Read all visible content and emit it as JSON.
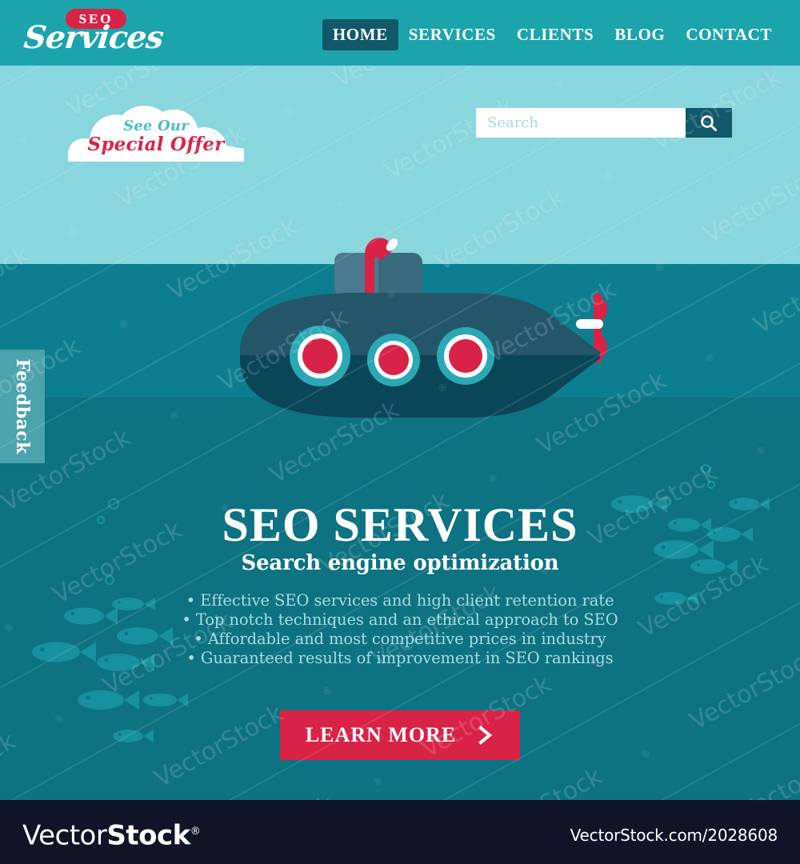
{
  "site": {
    "logo": {
      "badge_text": "SEO",
      "script_text": "Services",
      "badge_color": "#d92346"
    }
  },
  "header": {
    "background": "#1ca4ad",
    "nav": [
      {
        "label": "HOME",
        "active": true
      },
      {
        "label": "SERVICES",
        "active": false
      },
      {
        "label": "CLIENTS",
        "active": false
      },
      {
        "label": "BLOG",
        "active": false
      },
      {
        "label": "CONTACT",
        "active": false
      }
    ]
  },
  "promo": {
    "line1": "See Our",
    "line2": "Special Offer",
    "line1_color": "#4cbcc9",
    "line2_color": "#d92346"
  },
  "search": {
    "value": "",
    "placeholder": "Search",
    "icon": "search-icon",
    "button_color": "#11586a"
  },
  "feedback": {
    "label": "Feedback",
    "background": "#4ba3ad"
  },
  "hero": {
    "title": "SEO SERVICES",
    "subtitle": "Search engine optimization",
    "bullets": [
      "• Effective SEO services and high client retention rate",
      "• Top notch techniques and an ethical approach to SEO",
      "• Affordable and most competitive prices in industry",
      "• Guaranteed results of improvement in SEO rankings"
    ],
    "cta_label": "LEARN MORE",
    "cta_icon": "chevron-right-icon",
    "cta_color": "#d92346"
  },
  "illustration": {
    "name": "submarine-illustration",
    "sky_color": "#8ad6dd",
    "sea_color": "#0d7e8f",
    "deep_sea_color": "#0d7282",
    "hull_top_color": "#24566a",
    "hull_bottom_color": "#0a4558",
    "periscope_color": "#d92346",
    "porthole_ring_color": "#2ba8b5",
    "porthole_glass_color": "#d92346",
    "propeller_color": "#d92346",
    "fish_color": "#17909f"
  },
  "watermark": {
    "text": "VectorStock®"
  },
  "footer": {
    "brand_plain": "Vector",
    "brand_bold": "Stock",
    "brand_mark": "®",
    "url": "VectorStock.com/2028608",
    "background": "#111427"
  }
}
